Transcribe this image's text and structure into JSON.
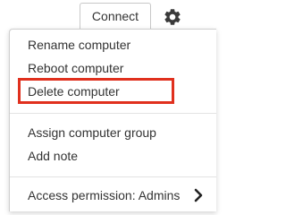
{
  "toolbar": {
    "connect_label": "Connect",
    "settings_icon": "gear-icon"
  },
  "menu": {
    "items": [
      {
        "id": "rename",
        "label": "Rename computer"
      },
      {
        "id": "reboot",
        "label": "Reboot computer"
      },
      {
        "id": "delete",
        "label": "Delete computer",
        "highlighted": true
      },
      {
        "id": "assign",
        "label": "Assign computer group"
      },
      {
        "id": "note",
        "label": "Add note"
      },
      {
        "id": "access",
        "label": "Access permission: Admins",
        "submenu_icon": "chevron-right-icon"
      }
    ]
  },
  "colors": {
    "highlight_border": "#e0301e",
    "text": "#333333",
    "divider": "#e3e3e3"
  }
}
